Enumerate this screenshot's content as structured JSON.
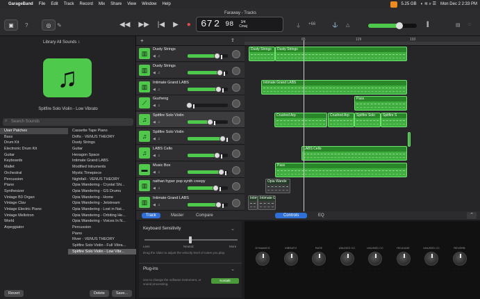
{
  "menubar": {
    "app": "GarageBand",
    "items": [
      "File",
      "Edit",
      "Track",
      "Record",
      "Mix",
      "Share",
      "View",
      "Window",
      "Help"
    ],
    "storage": "5.25 GB",
    "datetime": "Mon Dec 2  2:33 PM"
  },
  "window": {
    "title": "Faraway - Tracks"
  },
  "lcd": {
    "bar": "67",
    "beat": "2",
    "tempo": "98",
    "tempo_label": "tempo",
    "time_sig": "3/4",
    "key": "Cmaj",
    "transpose": "+66"
  },
  "library": {
    "header": "Library  All Sounds ↕",
    "patch_name": "Spitfire Solo Violin - Low Vibrato",
    "search_placeholder": "Search Sounds",
    "categories": [
      "User Patches",
      "Bass",
      "Drum Kit",
      "Electronic Drum Kit",
      "Guitar",
      "Keyboards",
      "Mallet",
      "Orchestral",
      "Percussion",
      "Piano",
      "Synthesizer",
      "Vintage B3 Organ",
      "Vintage Clav",
      "Vintage Electric Piano",
      "Vintage Mellotron",
      "World",
      "Arpeggiator"
    ],
    "patches": [
      "Cassette Tape Piano",
      "Drifts - VENUS THEORY",
      "Dusty Strings",
      "Guitar",
      "Hexagon Space",
      "Intimate Grand LABS",
      "Modified Intruments",
      "Mystic Timepiece",
      "Nightfall - VENUS THEORY",
      "Opia Wandering - Crystal Shi...",
      "Opia Wandering - GS Drums",
      "Opia Wandering - Home",
      "Opia Wandering - Jetstream",
      "Opia Wandering - Lost in Nat...",
      "Opia Wandering - Orbiting He...",
      "Opia Wandering - Voices In N...",
      "Percussion",
      "Piano",
      "River - VENUS THEORY",
      "Spitfire Solo Violin - Full Vibra...",
      "Spitfire Solo Violin - Low Vibr..."
    ],
    "revert": "Revert",
    "delete": "Delete",
    "save": "Save..."
  },
  "tracks": [
    {
      "name": "Dusty Strings",
      "icon": "▥"
    },
    {
      "name": "Dusty Strings",
      "icon": "▥"
    },
    {
      "name": "Intimate Grand LABS",
      "icon": "▥"
    },
    {
      "name": "Guzheng",
      "icon": "⟋"
    },
    {
      "name": "Spitfire Solo Violin",
      "icon": "♫"
    },
    {
      "name": "Spitfire Solo Violin",
      "icon": "♫"
    },
    {
      "name": "LABS Cello",
      "icon": "♫"
    },
    {
      "name": "Music Box",
      "icon": "▬"
    },
    {
      "name": "nathan hyper pop synth creepy",
      "icon": "▥"
    },
    {
      "name": "Intimate Grand LABS",
      "icon": "▥"
    }
  ],
  "ruler": {
    "marks": [
      "65",
      "129",
      "193"
    ]
  },
  "regions": [
    {
      "label": "Dusty Strings"
    },
    {
      "label": "Dusty Strings"
    },
    {
      "label": "Intimate Grand LABS"
    },
    {
      "label": "Pass"
    },
    {
      "label": "Crushed Arp"
    },
    {
      "label": "Crushed Arp"
    },
    {
      "label": "Spitfire Solo"
    },
    {
      "label": "Spitfire S"
    },
    {
      "label": "LABS Cello"
    },
    {
      "label": "Pass"
    },
    {
      "label": "Opia Wande"
    },
    {
      "label": "Intimate G"
    },
    {
      "label": "Intimate G"
    }
  ],
  "editor": {
    "tabs": {
      "track": "Track",
      "master": "Master",
      "compare": "Compare",
      "controls": "Controls",
      "eq": "EQ"
    },
    "kb_title": "Keyboard Sensitivity",
    "kb_less": "Less",
    "kb_neutral": "Neutral",
    "kb_more": "More",
    "kb_desc": "Drag the slider to adjust the velocity level of notes you play.",
    "plugins_title": "Plug-ins",
    "plugins_desc": "Use to change the software instrument, or sound processing.",
    "plugin_slot": "Kontakt",
    "knobs": [
      "DYNAMICS",
      "VIBRATO",
      "RATE",
      "UNUSED CC",
      "UNUSED CC",
      "RELEASE",
      "UNUSED CC",
      "REVERB"
    ]
  }
}
